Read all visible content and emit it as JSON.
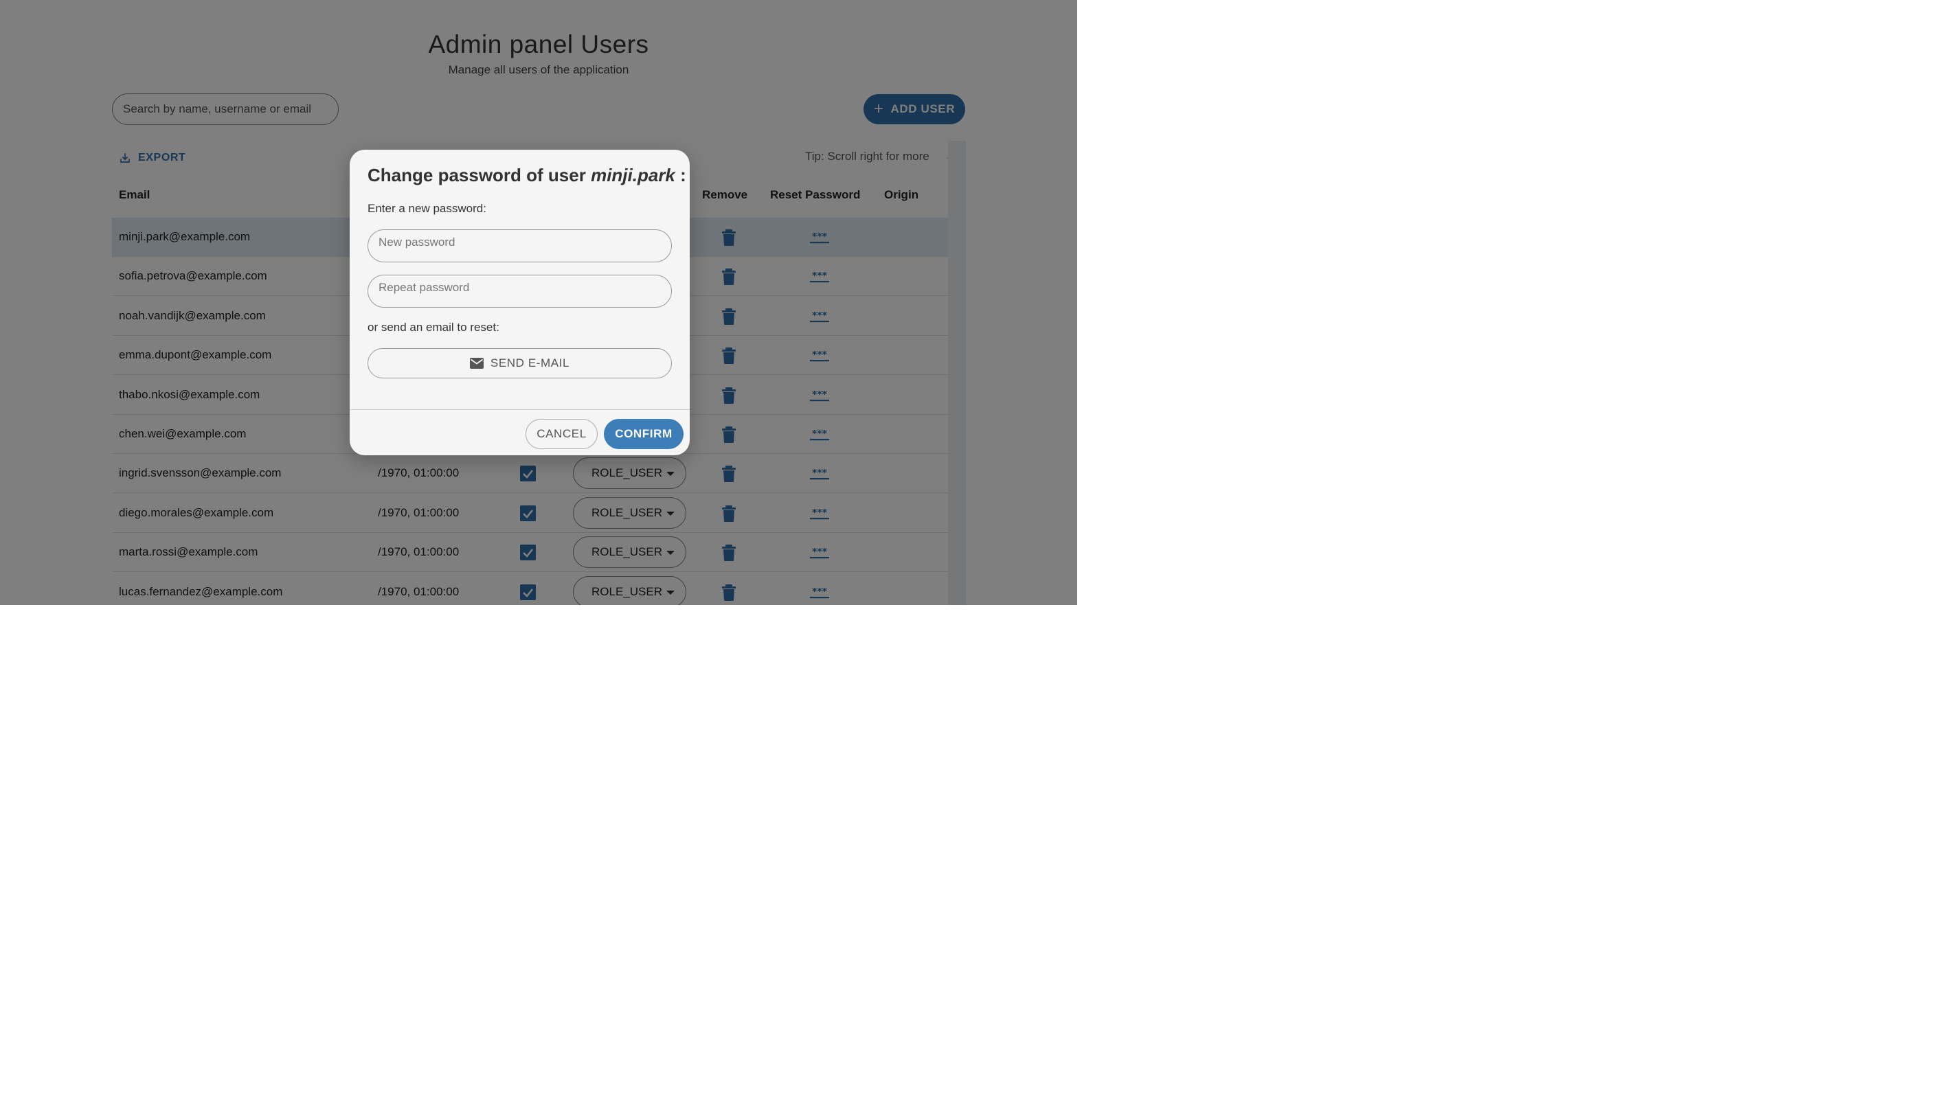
{
  "header": {
    "title": "Admin panel Users",
    "subtitle": "Manage all users of the application"
  },
  "search": {
    "placeholder": "Search by name, username or email",
    "value": ""
  },
  "toolbar": {
    "add_user_label": "ADD USER",
    "add_user_icon": "plus-icon",
    "export_label": "EXPORT",
    "export_icon": "download-icon",
    "tip": "Tip: Scroll right for more",
    "tip_arrow": "→"
  },
  "table": {
    "columns": {
      "email": "Email",
      "remove": "Remove",
      "reset_password": "Reset Password",
      "origin": "Origin"
    },
    "rows": [
      {
        "email": "minji.park@example.com",
        "date": "",
        "role": "",
        "selected": true
      },
      {
        "email": "sofia.petrova@example.com",
        "date": "",
        "role": ""
      },
      {
        "email": "noah.vandijk@example.com",
        "date": "",
        "role": ""
      },
      {
        "email": "emma.dupont@example.com",
        "date": "",
        "role": ""
      },
      {
        "email": "thabo.nkosi@example.com",
        "date": "",
        "role": ""
      },
      {
        "email": "chen.wei@example.com",
        "date": "",
        "role": ""
      },
      {
        "email": "ingrid.svensson@example.com",
        "date": "/1970, 01:00:00",
        "role": "ROLE_USER"
      },
      {
        "email": "diego.morales@example.com",
        "date": "/1970, 01:00:00",
        "role": "ROLE_USER"
      },
      {
        "email": "marta.rossi@example.com",
        "date": "/1970, 01:00:00",
        "role": "ROLE_USER"
      },
      {
        "email": "lucas.fernandez@example.com",
        "date": "/1970, 01:00:00",
        "role": "ROLE_USER"
      }
    ]
  },
  "dialog": {
    "title_prefix": "Change password of user",
    "username": "minji.park",
    "title_suffix": ":",
    "enter_label": "Enter a new password:",
    "new_password_placeholder": "New password",
    "repeat_password_placeholder": "Repeat password",
    "or_email_label": "or send an email to reset:",
    "send_email_label": "SEND E-MAIL",
    "send_email_icon": "mail-icon",
    "cancel_label": "CANCEL",
    "confirm_label": "CONFIRM"
  },
  "colors": {
    "primary": "#2f6fa8",
    "confirm": "#3d7db8",
    "overlay": "rgba(0,0,0,0.5)"
  }
}
